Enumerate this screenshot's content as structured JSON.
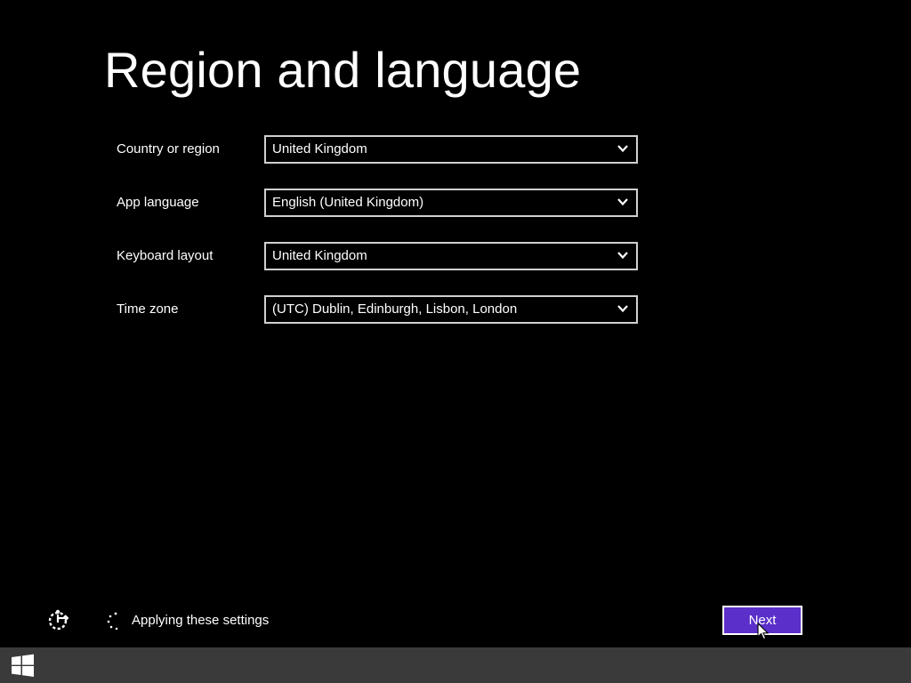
{
  "page": {
    "title": "Region and language"
  },
  "form": {
    "fields": [
      {
        "label": "Country or region",
        "value": "United Kingdom"
      },
      {
        "label": "App language",
        "value": "English (United Kingdom)"
      },
      {
        "label": "Keyboard layout",
        "value": "United Kingdom"
      },
      {
        "label": "Time zone",
        "value": "(UTC) Dublin, Edinburgh, Lisbon, London"
      }
    ]
  },
  "footer": {
    "status_text": "Applying these settings",
    "next_label": "Next",
    "accessibility_icon": "ease-of-access-icon",
    "spinner_icon": "loading-spinner-icon"
  },
  "taskbar": {
    "start_icon": "windows-logo-icon"
  },
  "colors": {
    "background": "#000000",
    "accent": "#5b2fc9",
    "text": "#ffffff",
    "taskbar": "#3a3a3a"
  }
}
